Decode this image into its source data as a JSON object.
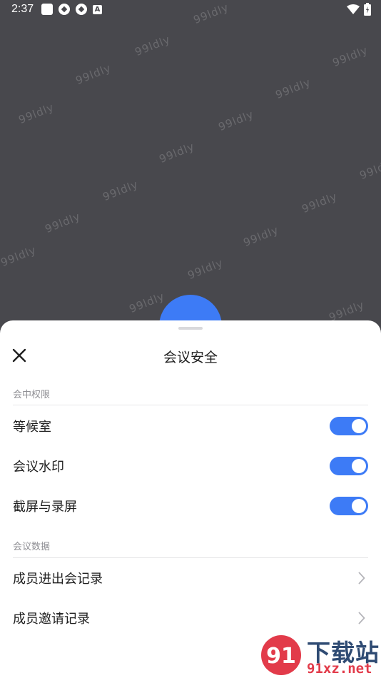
{
  "status_bar": {
    "time": "2:37",
    "icons": [
      "app-square-icon",
      "sync-icon",
      "sync-icon",
      "a-letter-icon",
      "wifi-icon",
      "battery-charging-icon"
    ]
  },
  "background": {
    "watermark_text": "99ldly",
    "color": "#48484d"
  },
  "sheet": {
    "title": "会议安全",
    "close_icon": "close-icon",
    "sections": [
      {
        "label": "会中权限",
        "rows": [
          {
            "label": "等候室",
            "control": "toggle",
            "on": true
          },
          {
            "label": "会议水印",
            "control": "toggle",
            "on": true
          },
          {
            "label": "截屏与录屏",
            "control": "toggle",
            "on": true
          }
        ]
      },
      {
        "label": "会议数据",
        "rows": [
          {
            "label": "成员进出会记录",
            "control": "chevron"
          },
          {
            "label": "成员邀请记录",
            "control": "chevron"
          }
        ]
      }
    ]
  },
  "brand_overlay": {
    "cn_text": "下载站",
    "url_text": "91xz.net",
    "badge_text": "91"
  },
  "colors": {
    "accent": "#3d7bf6",
    "text_primary": "#1f1f1f",
    "text_secondary": "#8f8f94"
  }
}
